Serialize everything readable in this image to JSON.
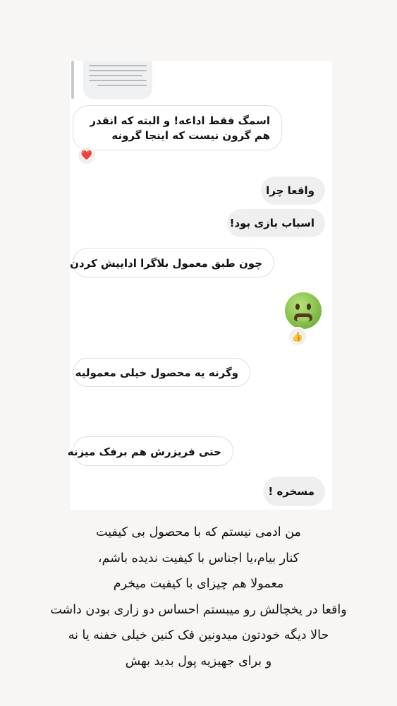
{
  "messages": {
    "m1": "اسمگ فقط اداعه! و البته که انقدر هم گرون نیست که اینجا گرونه",
    "m2": "واقعا چرا",
    "m3": "اسباب بازی بود!",
    "m4": "چون طبق معمول بلاگرا اداییش کردن",
    "m5": "وگرنه یه محصول خیلی معمولیه",
    "m6": "حتی فریزرش هم برفک میزنه",
    "m7": "مسخره !"
  },
  "reactions": {
    "heart": "❤️",
    "thumbs_up": "👍"
  },
  "icons": {
    "heart": "heart-icon",
    "thumbs": "thumbs-up-icon",
    "sticker": "nauseated-face-icon",
    "reply_preview": "reply-thumbnail"
  },
  "caption": {
    "line1": "من ادمی نیستم که با محصول بی کیفیت",
    "line2": "کنار بیام،یا اجناس با کیفیت ندیده باشم،",
    "line3": "معمولا هم چیزای با کیفیت میخرم",
    "line4": "واقعا در یخچالش رو میبستم احساس دو زاری بودن داشت",
    "line5": "حالا دیگه خودتون میدونین فک کنین خیلی خفنه یا نه",
    "line6": "و برای جهیزیه پول بدید بهش"
  }
}
